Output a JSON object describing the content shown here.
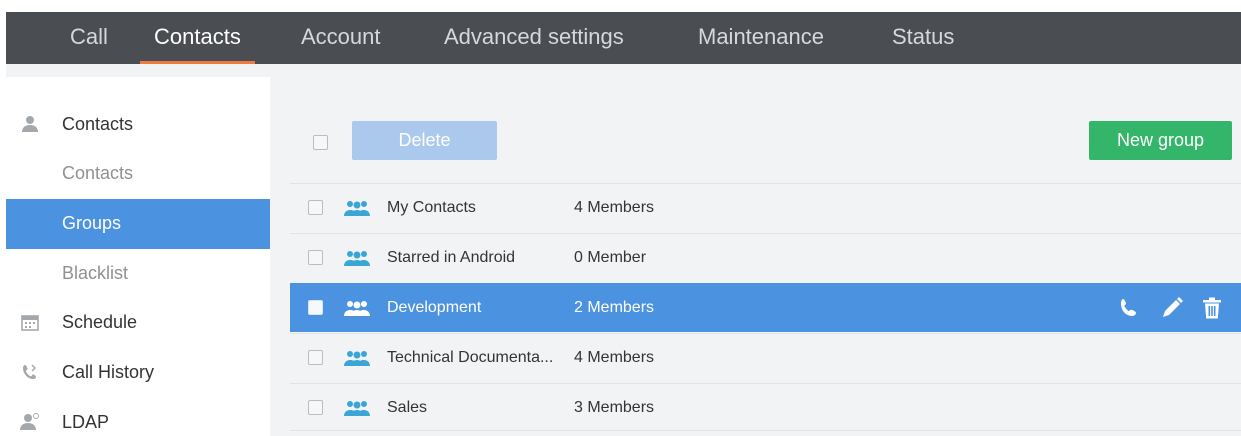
{
  "nav": {
    "items": [
      "Call",
      "Contacts",
      "Account",
      "Advanced settings",
      "Maintenance",
      "Status"
    ],
    "active": "Contacts",
    "accent": "#f07b3c"
  },
  "sidebar": {
    "sections": [
      {
        "label": "Contacts",
        "icon": "person-icon"
      },
      {
        "label": "Schedule",
        "icon": "calendar-icon"
      },
      {
        "label": "Call History",
        "icon": "phone-history-icon"
      },
      {
        "label": "LDAP",
        "icon": "ldap-person-icon"
      }
    ],
    "sub_items": [
      "Contacts",
      "Groups",
      "Blacklist"
    ],
    "active_sub": "Groups"
  },
  "toolbar": {
    "delete_label": "Delete",
    "new_group_label": "New group"
  },
  "groups": [
    {
      "name": "My Contacts",
      "members": "4 Members"
    },
    {
      "name": "Starred in Android",
      "members": "0 Member"
    },
    {
      "name": "Development",
      "members": "2 Members",
      "selected": true
    },
    {
      "name": "Technical Documenta...",
      "members": "4 Members"
    },
    {
      "name": "Sales",
      "members": "3 Members"
    }
  ],
  "row_actions": [
    "call-icon",
    "edit-icon",
    "delete-icon"
  ],
  "colors": {
    "nav_bg": "#4a4d52",
    "selected": "#4b92e0",
    "new_group": "#33b56a",
    "delete_disabled": "#aac9ec",
    "group_icon": "#3aa6d6"
  }
}
